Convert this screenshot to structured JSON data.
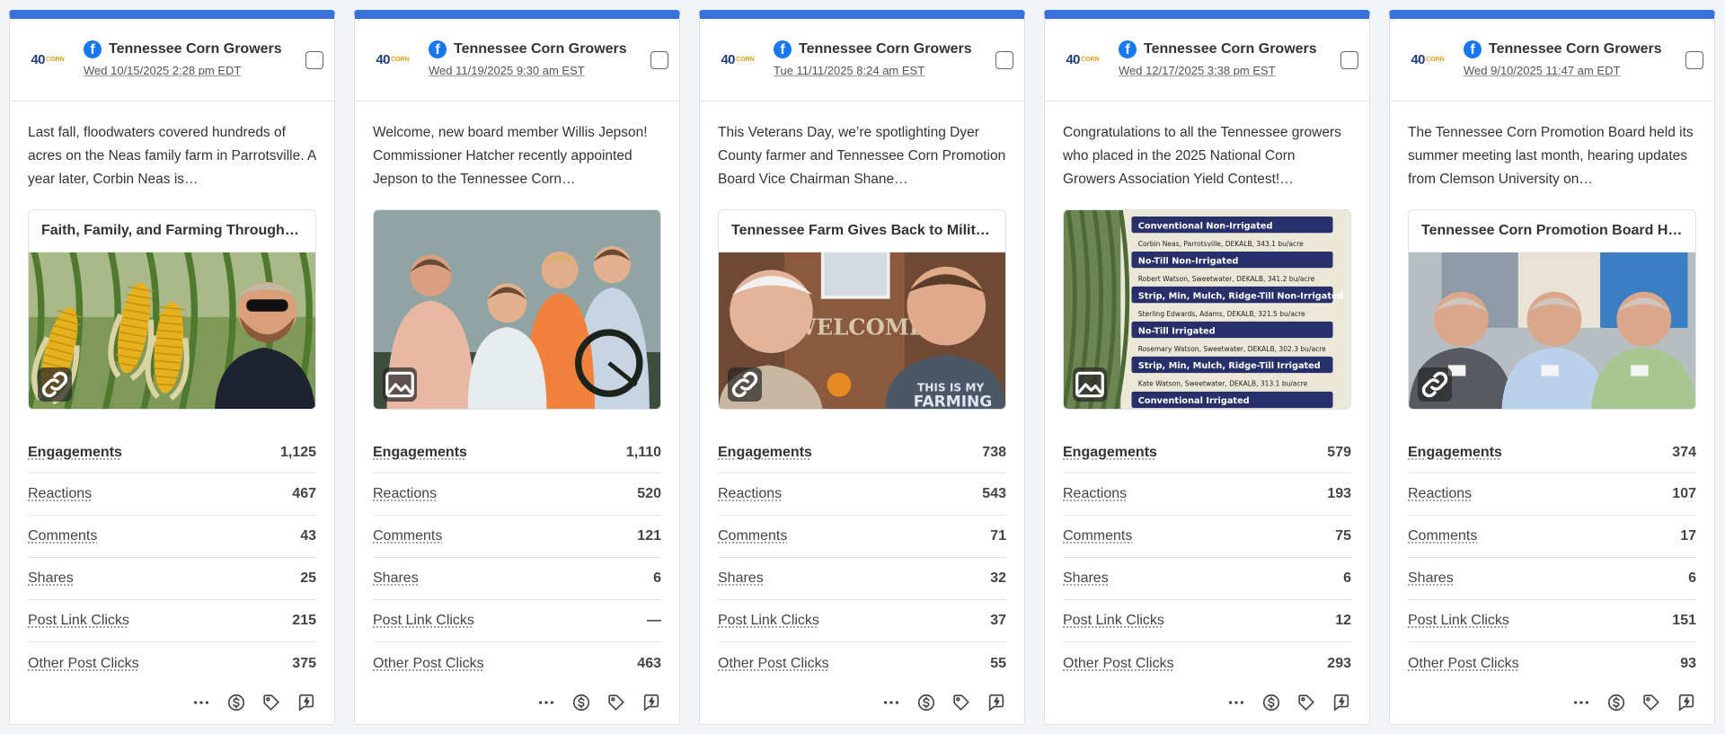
{
  "metric_labels": {
    "engagements": "Engagements",
    "reactions": "Reactions",
    "comments": "Comments",
    "shares": "Shares",
    "post_link_clicks": "Post Link Clicks",
    "other_post_clicks": "Other Post Clicks"
  },
  "colors": {
    "accent_bar": "#3a72dc",
    "facebook": "#1877f2"
  },
  "posts": [
    {
      "account": "Tennessee Corn Growers",
      "logo_text": "40",
      "logo_sub": "CORN",
      "date": "Wed 10/15/2025 2:28 pm EDT",
      "text": "Last fall, floodwaters covered hundreds of acres on the Neas family farm in Parrotsville. A year later, Corbin Neas is…",
      "media_title": "Faith, Family, and Farming Through …",
      "media_icon": "link-icon",
      "engagements": "1,125",
      "reactions": "467",
      "comments": "43",
      "shares": "25",
      "post_link_clicks": "215",
      "other_post_clicks": "375"
    },
    {
      "account": "Tennessee Corn Growers",
      "logo_text": "40",
      "logo_sub": "CORN",
      "date": "Wed 11/19/2025 9:30 am EST",
      "text": "Welcome, new board member Willis Jepson! Commissioner Hatcher recently appointed Jepson to the Tennessee Corn…",
      "media_title": "",
      "media_icon": "image-icon",
      "engagements": "1,110",
      "reactions": "520",
      "comments": "121",
      "shares": "6",
      "post_link_clicks": "—",
      "other_post_clicks": "463"
    },
    {
      "account": "Tennessee Corn Growers",
      "logo_text": "40",
      "logo_sub": "CORN",
      "date": "Tue 11/11/2025 8:24 am EST",
      "text": "This Veterans Day, we’re spotlighting Dyer County farmer and Tennessee Corn Promotion Board Vice Chairman Shane…",
      "media_title": "Tennessee Farm Gives Back to Milit…",
      "media_icon": "link-icon",
      "engagements": "738",
      "reactions": "543",
      "comments": "71",
      "shares": "32",
      "post_link_clicks": "37",
      "other_post_clicks": "55"
    },
    {
      "account": "Tennessee Corn Growers",
      "logo_text": "40",
      "logo_sub": "CORN",
      "date": "Wed 12/17/2025 3:38 pm EST",
      "text": "Congratulations to all the Tennessee growers who placed in the 2025 National Corn Growers Association Yield Contest!…",
      "media_title": "",
      "media_icon": "image-icon",
      "engagements": "579",
      "reactions": "193",
      "comments": "75",
      "shares": "6",
      "post_link_clicks": "12",
      "other_post_clicks": "293"
    },
    {
      "account": "Tennessee Corn Growers",
      "logo_text": "40",
      "logo_sub": "CORN",
      "date": "Wed 9/10/2025 11:47 am EDT",
      "text": "The Tennessee Corn Promotion Board held its summer meeting last month, hearing updates from Clemson University on…",
      "media_title": "Tennessee Corn Promotion Board H…",
      "media_icon": "link-icon",
      "engagements": "374",
      "reactions": "107",
      "comments": "17",
      "shares": "6",
      "post_link_clicks": "151",
      "other_post_clicks": "93"
    }
  ],
  "yield_contest_image": {
    "rows": [
      {
        "type": "header",
        "text": "Conventional Non-Irrigated"
      },
      {
        "type": "entry",
        "text": "Corbin Neas, Parrotsville, DEKALB, 343.1 bu/acre"
      },
      {
        "type": "header",
        "text": "No-Till Non-Irrigated"
      },
      {
        "type": "entry",
        "text": "Robert Watson, Sweetwater, DEKALB, 341.2 bu/acre"
      },
      {
        "type": "header",
        "text": "Strip, Min, Mulch, Ridge-Till Non-Irrigated"
      },
      {
        "type": "entry",
        "text": "Sterling Edwards, Adams, DEKALB, 321.5 bu/acre"
      },
      {
        "type": "header",
        "text": "No-Till Irrigated"
      },
      {
        "type": "entry",
        "text": "Rosemary Watson, Sweetwater, DEKALB, 302.3 bu/acre"
      },
      {
        "type": "header",
        "text": "Strip, Min, Mulch, Ridge-Till Irrigated"
      },
      {
        "type": "entry",
        "text": "Kate Watson, Sweetwater, DEKALB, 313.1 bu/acre"
      },
      {
        "type": "header",
        "text": "Conventional Irrigated"
      }
    ]
  },
  "veterans_image": {
    "sign_text": "WELCOME",
    "shirt_text_1": "THIS IS MY",
    "shirt_text_2": "FARMING"
  },
  "action_icons": [
    "more-icon",
    "dollar-icon",
    "tag-icon",
    "boost-icon"
  ]
}
